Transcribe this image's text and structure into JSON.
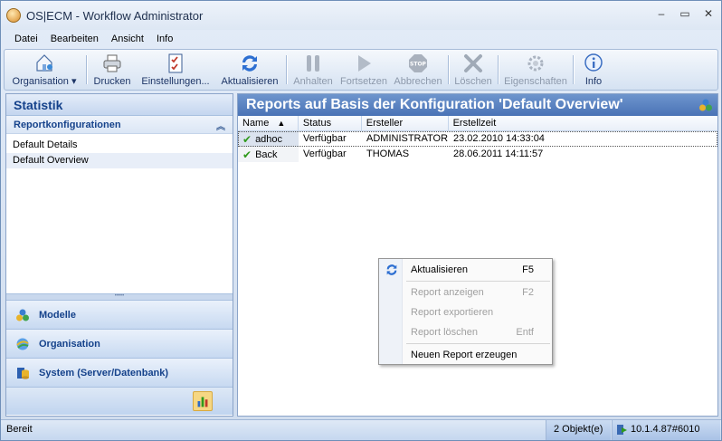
{
  "window": {
    "title": "OS|ECM  - Workflow Administrator",
    "controls": {
      "minimize": "–",
      "maximize": "▭",
      "close": "✕"
    }
  },
  "menu": [
    "Datei",
    "Bearbeiten",
    "Ansicht",
    "Info"
  ],
  "toolbar": {
    "organisation": "Organisation",
    "drucken": "Drucken",
    "einstellungen": "Einstellungen...",
    "aktualisieren": "Aktualisieren",
    "anhalten": "Anhalten",
    "fortsetzen": "Fortsetzen",
    "abbrechen": "Abbrechen",
    "loeschen": "Löschen",
    "eigenschaften": "Eigenschaften",
    "info": "Info",
    "stop_text": "STOP"
  },
  "left": {
    "header": "Statistik",
    "section": "Reportkonfigurationen",
    "items": [
      "Default Details",
      "Default Overview"
    ],
    "grip": "•••••",
    "nav": [
      "Modelle",
      "Organisation",
      "System (Server/Datenbank)"
    ]
  },
  "right": {
    "header": "Reports auf Basis der Konfiguration 'Default Overview'",
    "columns": [
      "Name",
      "Status",
      "Ersteller",
      "Erstellzeit"
    ],
    "sort_indicator": "▲",
    "rows": [
      {
        "name": "adhoc",
        "status": "Verfügbar",
        "ersteller": "ADMINISTRATOR",
        "zeit": "23.02.2010 14:33:04"
      },
      {
        "name": "Back",
        "status": "Verfügbar",
        "ersteller": "THOMAS",
        "zeit": "28.06.2011 14:11:57"
      }
    ]
  },
  "context_menu": [
    {
      "label": "Aktualisieren",
      "shortcut": "F5"
    },
    {
      "label": "Report anzeigen",
      "shortcut": "F2"
    },
    {
      "label": "Report exportieren",
      "shortcut": ""
    },
    {
      "label": "Report löschen",
      "shortcut": "Entf"
    },
    {
      "label": "Neuen Report erzeugen",
      "shortcut": ""
    }
  ],
  "status": {
    "left": "Bereit",
    "count": "2 Objekt(e)",
    "server": "10.1.4.87#6010"
  },
  "colors": {
    "header_blue": "#4a73b6",
    "check_green": "#2f9a1c",
    "title_text": "#15428b"
  }
}
